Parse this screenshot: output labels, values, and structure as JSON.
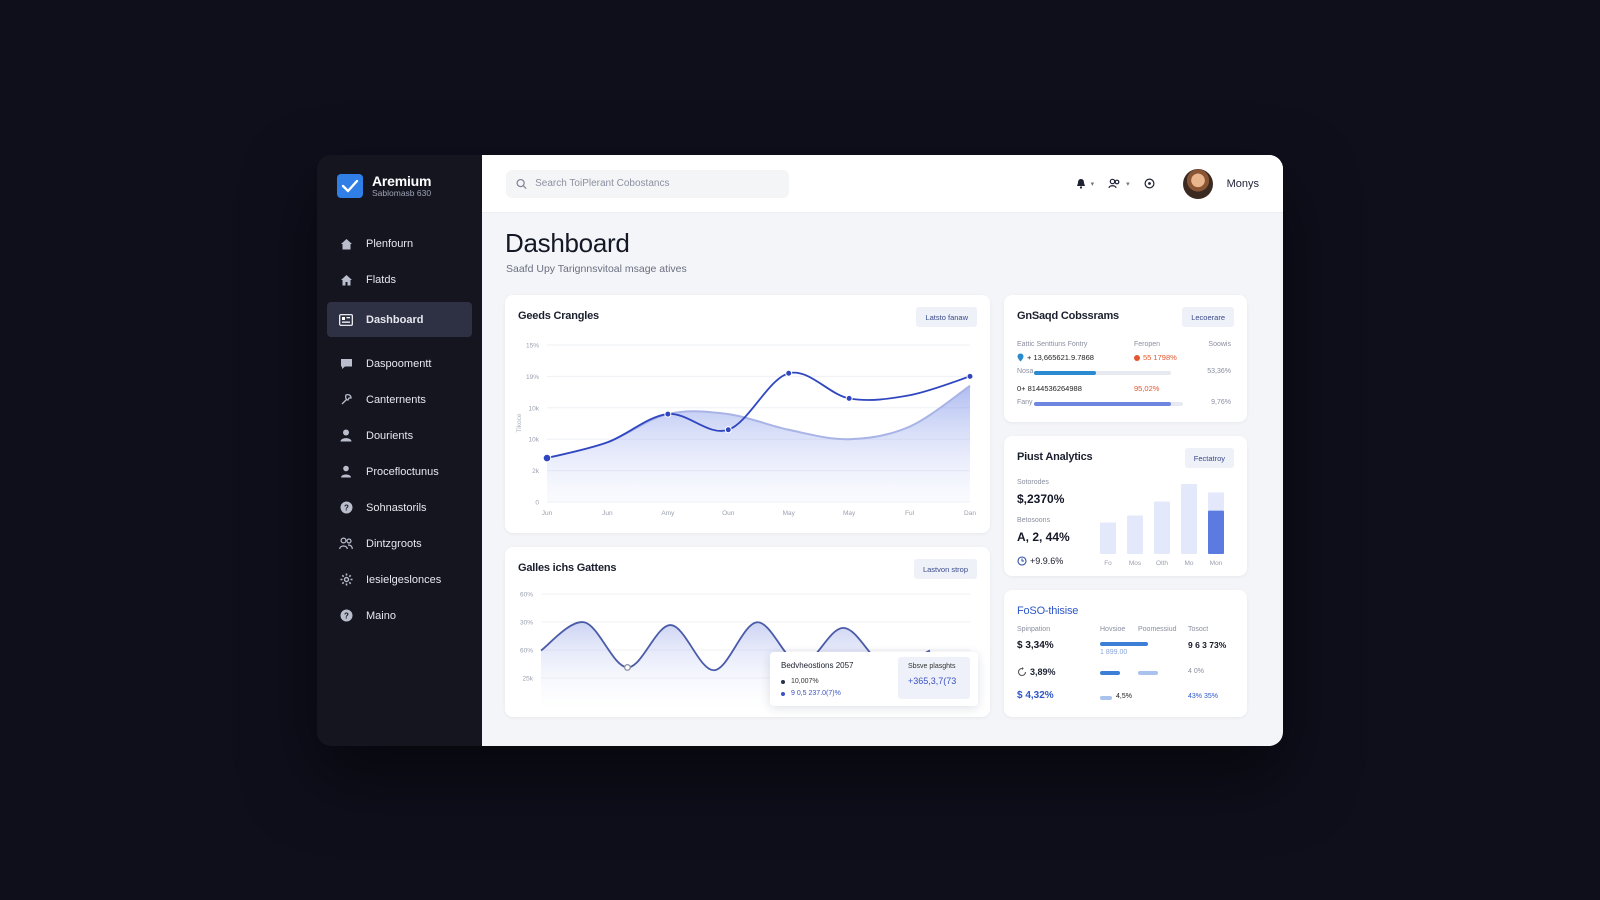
{
  "brand": {
    "name": "Aremium",
    "subtitle": "Sablomasb 630"
  },
  "nav": [
    {
      "label": "Plenfourn",
      "icon": "home-icon"
    },
    {
      "label": "Flatds",
      "icon": "house-icon"
    },
    {
      "label": "Dashboard",
      "icon": "dashboard-icon",
      "active": true
    },
    {
      "label": "Daspoomentt",
      "icon": "message-icon"
    },
    {
      "label": "Canternents",
      "icon": "tools-icon"
    },
    {
      "label": "Dourients",
      "icon": "user-icon"
    },
    {
      "label": "Procefloctunus",
      "icon": "person-icon"
    },
    {
      "label": "Sohnastorils",
      "icon": "help-circle-icon"
    },
    {
      "label": "Dintzgroots",
      "icon": "users-icon"
    },
    {
      "label": "Iesielgeslonces",
      "icon": "gear-icon"
    },
    {
      "label": "Maino",
      "icon": "question-icon"
    }
  ],
  "search": {
    "placeholder": "Search ToiPlerant Cobostancs",
    "value": ""
  },
  "user": {
    "name": "Monys"
  },
  "page": {
    "title": "Dashboard",
    "subtitle": "Saafd Upy Tarignnsvitoal msage atives"
  },
  "cards": {
    "main_chart": {
      "title": "Geeds Crangles",
      "button": "Latsto fanaw"
    },
    "wave_chart": {
      "title": "Galles ichs Gattens",
      "button": "Lastvon strop",
      "tooltip": {
        "title": "Bedvheostions 2057",
        "row1": "10,007%",
        "row2": "9 0,5 237.0(7)%",
        "right_label": "Sbsve plasghts",
        "right_value": "+365,3,7(73"
      }
    },
    "top_right": {
      "title": "GnSaqd Cobssrams",
      "button": "Lecoerare",
      "headers": [
        "Eattic Senttiuns Fontry",
        "Feropen",
        "Soowis"
      ],
      "rows": [
        {
          "id": "+ 13,665621.9.7868",
          "delta": "55 1798%",
          "right": ""
        },
        {
          "label": "Nosa",
          "right": "53,36%",
          "fill": 0.45
        },
        {
          "id": "0+ 8144536264988",
          "delta": "95,02%",
          "right": ""
        },
        {
          "label": "Fany",
          "right": "9,76%",
          "fill": 0.92
        }
      ]
    },
    "pivot": {
      "title": "Piust Analytics",
      "button": "Fectatroy",
      "label1": "Sotorodes",
      "value1": "$,2370%",
      "label2": "Betosoons",
      "value2": "A, 2, 44%",
      "value3": "+9.9.6%",
      "bars_x": [
        "Fo",
        "Mos",
        "Olth",
        "Mo",
        "Mon"
      ]
    },
    "foso": {
      "title": "FoSO-thisise",
      "headers": [
        "Spinpation",
        "Hovsioe",
        "Poomessiud",
        "Tosoct"
      ],
      "values": [
        "$ 3,34%",
        "3,89%",
        "$ 4,32%"
      ],
      "sub": [
        "1 899.00",
        "4,5%"
      ],
      "right_values": [
        "9 6 3 73%",
        "4 0%",
        "43% 35%"
      ]
    }
  },
  "chart_data": [
    {
      "type": "line",
      "title": "Geeds Crangles",
      "categories": [
        "Jun",
        "Jun",
        "Amy",
        "Oun",
        "May",
        "May",
        "Ful",
        "Dan"
      ],
      "yticks": [
        "0",
        "2k",
        "10k",
        "10k",
        "19%",
        "15%"
      ],
      "ylabel": "Tikoce",
      "ylim": [
        0,
        5
      ],
      "series": [
        {
          "values": [
            1.4,
            1.9,
            2.8,
            2.3,
            4.1,
            3.3,
            3.4,
            4.0
          ],
          "color": "#2f46c0"
        },
        {
          "values": [
            1.4,
            1.9,
            2.8,
            2.8,
            2.3,
            2.0,
            2.4,
            3.7
          ],
          "color": "#a9b4e6"
        }
      ]
    },
    {
      "type": "line",
      "title": "Galles ichs Gattens",
      "yticks": [
        "25k",
        "60%",
        "30%",
        "60%"
      ],
      "ylim": [
        0,
        4
      ],
      "series": [
        {
          "values": [
            2.0,
            3.0,
            1.4,
            2.9,
            1.3,
            3.0,
            1.5,
            2.8,
            1.4,
            2.0
          ],
          "color": "#4a5ba8"
        }
      ]
    },
    {
      "type": "bar",
      "title": "Piust Analytics",
      "categories": [
        "Fo",
        "Mos",
        "Olth",
        "Mo",
        "Mon"
      ],
      "values": [
        0.45,
        0.55,
        0.75,
        1.0,
        0.95
      ],
      "highlight_index": 4,
      "ylim": [
        0,
        1
      ]
    }
  ]
}
